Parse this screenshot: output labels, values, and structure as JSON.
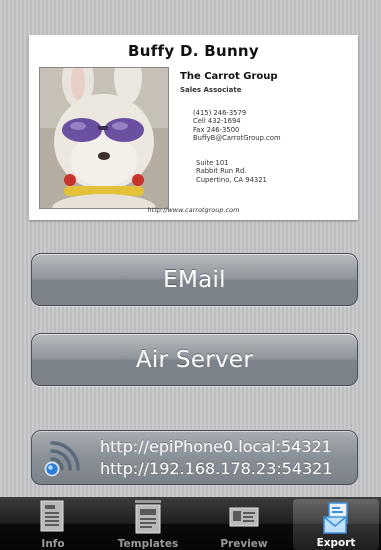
{
  "card": {
    "name": "Buffy D. Bunny",
    "company": "The Carrot Group",
    "title": "Sales Associate",
    "contact": [
      "(415) 246-3579",
      "Cell 432-1694",
      "Fax 246-3500",
      "BuffyB@CarrotGroup.com"
    ],
    "address": [
      "Suite 101",
      "Rabbit Run Rd.",
      "Cupertino,  CA  94321"
    ],
    "url": "http://www.carrotgroup.com"
  },
  "buttons": {
    "email": "EMail",
    "air_server": "Air Server"
  },
  "server": {
    "line1": "http://epiPhone0.local:54321",
    "line2": "http://192.168.178.23:54321"
  },
  "tabs": [
    {
      "label": "Info",
      "icon": "info-icon"
    },
    {
      "label": "Templates",
      "icon": "templates-icon"
    },
    {
      "label": "Preview",
      "icon": "preview-icon"
    },
    {
      "label": "Export",
      "icon": "export-icon",
      "selected": true
    }
  ],
  "colors": {
    "button_text": "#ffffff",
    "tab_active_icon": "#3f8fd8",
    "wifi_accent": "#2d7fd6"
  }
}
